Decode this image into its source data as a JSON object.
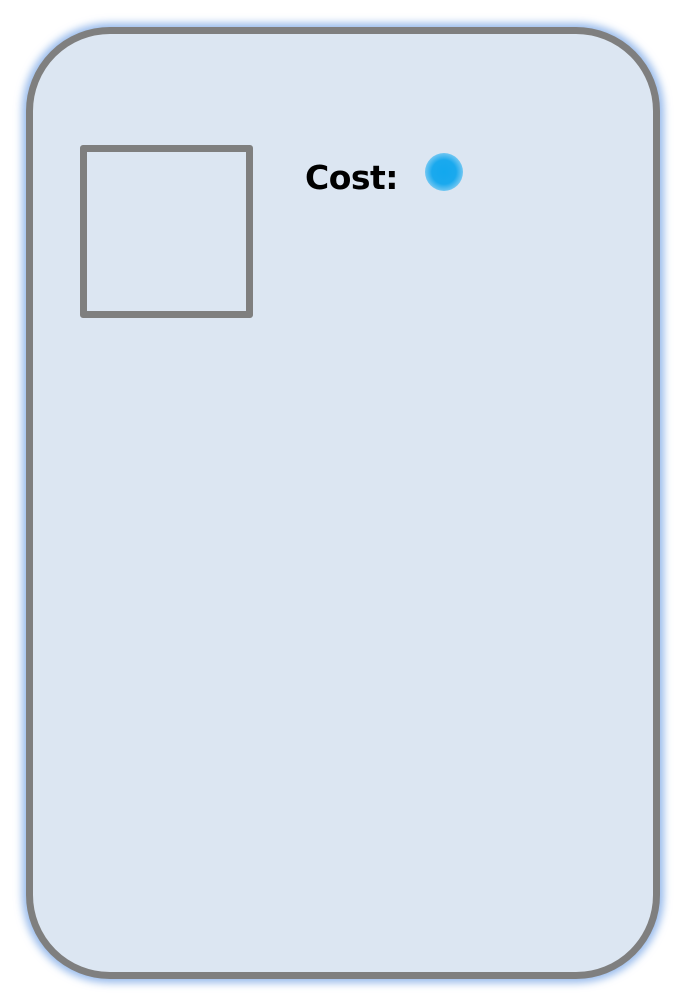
{
  "card": {
    "cost_label": "Cost:",
    "cost_gem_icon": "blue-dot-icon",
    "colors": {
      "card_fill": "#dce6f2",
      "border": "#7f7f7f",
      "glow": "#78a5e6",
      "gem": "#12a8ee",
      "text": "#000000"
    }
  }
}
